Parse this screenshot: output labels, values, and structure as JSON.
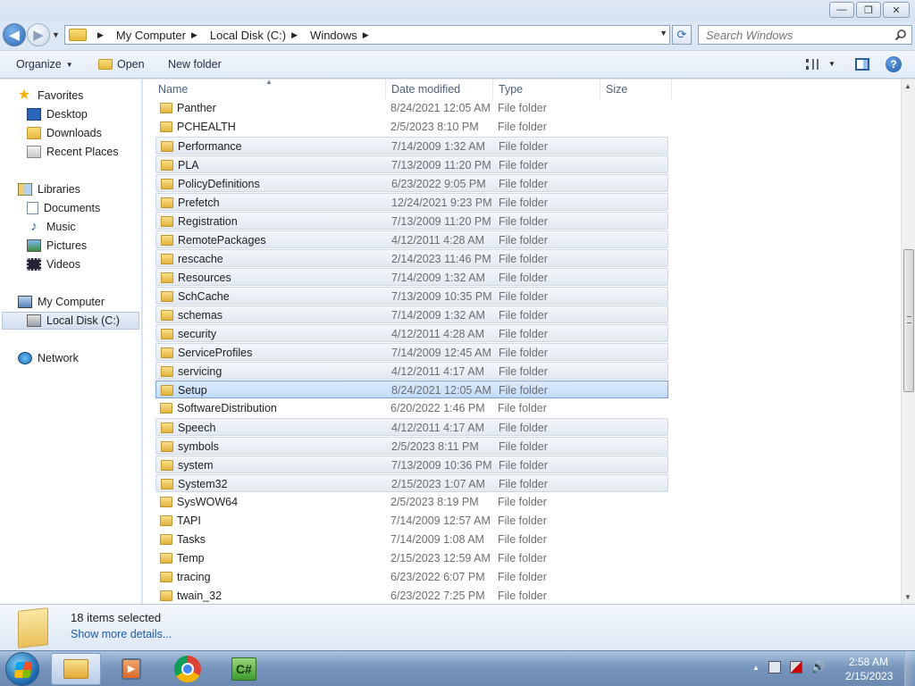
{
  "window": {
    "controls": {
      "minimize": "—",
      "maximize": "❐",
      "close": "✕"
    }
  },
  "address": {
    "crumbs": [
      "My Computer",
      "Local Disk (C:)",
      "Windows"
    ],
    "search_placeholder": "Search Windows"
  },
  "toolbar": {
    "organize": "Organize",
    "open": "Open",
    "new_folder": "New folder"
  },
  "nav": {
    "favorites": "Favorites",
    "desktop": "Desktop",
    "downloads": "Downloads",
    "recent_places": "Recent Places",
    "libraries": "Libraries",
    "documents": "Documents",
    "music": "Music",
    "pictures": "Pictures",
    "videos": "Videos",
    "my_computer": "My Computer",
    "local_disk": "Local Disk (C:)",
    "network": "Network"
  },
  "columns": {
    "name": "Name",
    "date": "Date modified",
    "type": "Type",
    "size": "Size"
  },
  "files": [
    {
      "name": "Panther",
      "date": "8/24/2021 12:05 AM",
      "type": "File folder",
      "state": "normal"
    },
    {
      "name": "PCHEALTH",
      "date": "2/5/2023 8:10 PM",
      "type": "File folder",
      "state": "normal"
    },
    {
      "name": "Performance",
      "date": "7/14/2009 1:32 AM",
      "type": "File folder",
      "state": "selected"
    },
    {
      "name": "PLA",
      "date": "7/13/2009 11:20 PM",
      "type": "File folder",
      "state": "selected"
    },
    {
      "name": "PolicyDefinitions",
      "date": "6/23/2022 9:05 PM",
      "type": "File folder",
      "state": "selected"
    },
    {
      "name": "Prefetch",
      "date": "12/24/2021 9:23 PM",
      "type": "File folder",
      "state": "selected"
    },
    {
      "name": "Registration",
      "date": "7/13/2009 11:20 PM",
      "type": "File folder",
      "state": "selected"
    },
    {
      "name": "RemotePackages",
      "date": "4/12/2011 4:28 AM",
      "type": "File folder",
      "state": "selected"
    },
    {
      "name": "rescache",
      "date": "2/14/2023 11:46 PM",
      "type": "File folder",
      "state": "selected"
    },
    {
      "name": "Resources",
      "date": "7/14/2009 1:32 AM",
      "type": "File folder",
      "state": "selected"
    },
    {
      "name": "SchCache",
      "date": "7/13/2009 10:35 PM",
      "type": "File folder",
      "state": "selected"
    },
    {
      "name": "schemas",
      "date": "7/14/2009 1:32 AM",
      "type": "File folder",
      "state": "selected"
    },
    {
      "name": "security",
      "date": "4/12/2011 4:28 AM",
      "type": "File folder",
      "state": "selected"
    },
    {
      "name": "ServiceProfiles",
      "date": "7/14/2009 12:45 AM",
      "type": "File folder",
      "state": "selected"
    },
    {
      "name": "servicing",
      "date": "4/12/2011 4:17 AM",
      "type": "File folder",
      "state": "selected"
    },
    {
      "name": "Setup",
      "date": "8/24/2021 12:05 AM",
      "type": "File folder",
      "state": "focus"
    },
    {
      "name": "SoftwareDistribution",
      "date": "6/20/2022 1:46 PM",
      "type": "File folder",
      "state": "normal"
    },
    {
      "name": "Speech",
      "date": "4/12/2011 4:17 AM",
      "type": "File folder",
      "state": "selected"
    },
    {
      "name": "symbols",
      "date": "2/5/2023 8:11 PM",
      "type": "File folder",
      "state": "selected"
    },
    {
      "name": "system",
      "date": "7/13/2009 10:36 PM",
      "type": "File folder",
      "state": "selected"
    },
    {
      "name": "System32",
      "date": "2/15/2023 1:07 AM",
      "type": "File folder",
      "state": "selected"
    },
    {
      "name": "SysWOW64",
      "date": "2/5/2023 8:19 PM",
      "type": "File folder",
      "state": "normal"
    },
    {
      "name": "TAPI",
      "date": "7/14/2009 12:57 AM",
      "type": "File folder",
      "state": "normal"
    },
    {
      "name": "Tasks",
      "date": "7/14/2009 1:08 AM",
      "type": "File folder",
      "state": "normal"
    },
    {
      "name": "Temp",
      "date": "2/15/2023 12:59 AM",
      "type": "File folder",
      "state": "normal"
    },
    {
      "name": "tracing",
      "date": "6/23/2022 6:07 PM",
      "type": "File folder",
      "state": "normal"
    },
    {
      "name": "twain_32",
      "date": "6/23/2022 7:25 PM",
      "type": "File folder",
      "state": "normal"
    }
  ],
  "details": {
    "count": "18 items selected",
    "more": "Show more details..."
  },
  "taskbar": {
    "time": "2:58 AM",
    "date": "2/15/2023",
    "csharp_label": "C#"
  }
}
